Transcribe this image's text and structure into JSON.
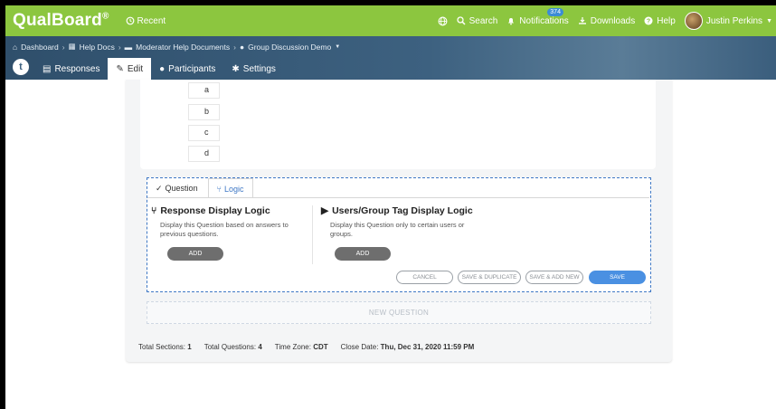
{
  "topbar": {
    "logo": "QualBoard",
    "logo_mark": "®",
    "recent": "Recent",
    "search": "Search",
    "notifications": "Notifications",
    "notifications_count": "374",
    "downloads": "Downloads",
    "help": "Help",
    "user": "Justin Perkins"
  },
  "breadcrumb": [
    "Dashboard",
    "Help Docs",
    "Moderator Help Documents",
    "Group Discussion Demo"
  ],
  "tabs": [
    {
      "label": "Responses"
    },
    {
      "label": "Edit"
    },
    {
      "label": "Participants"
    },
    {
      "label": "Settings"
    }
  ],
  "tab_t_letter": "t",
  "question": {
    "options": [
      "a",
      "b",
      "c",
      "d"
    ]
  },
  "editor": {
    "tab_question": "Question",
    "tab_logic": "Logic",
    "response_title": "Response Display Logic",
    "response_desc_1": "Display this Question based on answers to",
    "response_desc_2": "previous questions.",
    "users_title": "Users/Group Tag Display Logic",
    "users_desc_1": "Display this Question only to certain users or",
    "users_desc_2": "groups.",
    "add_label": "ADD",
    "cancel": "CANCEL",
    "save_duplicate": "SAVE & DUPLICATE",
    "save_add_new": "SAVE & ADD NEW",
    "save": "SAVE"
  },
  "new_question": "NEW QUESTION",
  "footer": {
    "sections_label": "Total Sections:",
    "sections_value": "1",
    "questions_label": "Total Questions:",
    "questions_value": "4",
    "tz_label": "Time Zone:",
    "tz_value": "CDT",
    "close_label": "Close Date:",
    "close_value": "Thu, Dec 31, 2020 11:59 PM"
  },
  "colors": {
    "brand_green": "#8cc63f",
    "nav_blue": "#3d6180",
    "accent_blue": "#4a90e2"
  }
}
